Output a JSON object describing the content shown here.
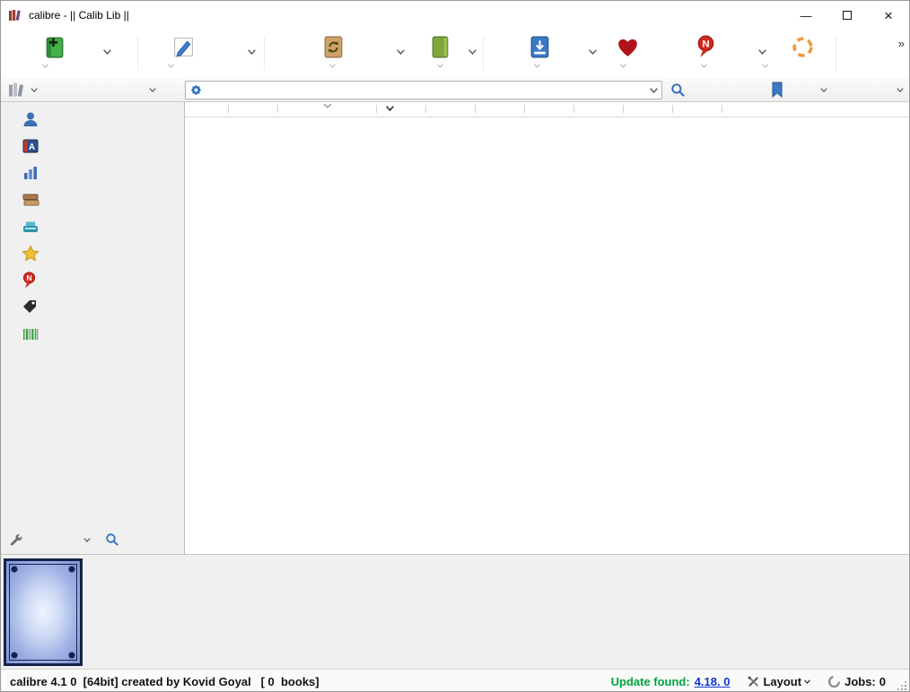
{
  "window": {
    "title": "calibre - || Calib Lib ||"
  },
  "window_controls": {
    "minimize_glyph": "—",
    "close_glyph": "×"
  },
  "toolbar": {
    "overflow_label": "»",
    "buttons": [
      {
        "id": "add-books",
        "icon": "add-books-icon",
        "has_menu": true
      },
      {
        "id": "edit-metadata",
        "icon": "edit-metadata-icon",
        "has_menu": true
      },
      {
        "id": "convert-books",
        "icon": "convert-books-icon",
        "has_menu": true
      },
      {
        "id": "view-book",
        "icon": "view-book-icon",
        "has_menu": true
      },
      {
        "id": "save-to-disk",
        "icon": "save-to-disk-icon",
        "has_menu": true
      },
      {
        "id": "donate",
        "icon": "donate-heart-icon",
        "has_menu": false
      },
      {
        "id": "fetch-news",
        "icon": "fetch-news-icon",
        "has_menu": true
      },
      {
        "id": "connect-share",
        "icon": "connect-share-icon",
        "has_menu": false
      }
    ]
  },
  "searchbar": {
    "library_switcher_icon": "library-books-icon",
    "gear_icon": "advanced-search-gear-icon",
    "search_value": "",
    "search_placeholder": "",
    "search_button_icon": "search-magnifier-icon",
    "saved_search_icon": "saved-search-bookmark-icon"
  },
  "sidebar": {
    "items": [
      {
        "id": "authors",
        "icon": "authors-icon"
      },
      {
        "id": "languages",
        "icon": "languages-icon"
      },
      {
        "id": "series",
        "icon": "series-icon"
      },
      {
        "id": "formats",
        "icon": "formats-icon"
      },
      {
        "id": "publisher",
        "icon": "publisher-icon"
      },
      {
        "id": "ratings",
        "icon": "ratings-star-icon"
      },
      {
        "id": "news",
        "icon": "news-icon"
      },
      {
        "id": "tags",
        "icon": "tags-icon"
      },
      {
        "id": "identifiers",
        "icon": "identifiers-barcode-icon"
      }
    ],
    "footer": {
      "configure_icon": "configure-wrench-icon",
      "find_icon": "find-magnifier-icon"
    }
  },
  "booklist": {
    "columns": [
      "",
      "",
      "",
      "",
      "",
      "",
      "",
      "",
      "",
      ""
    ]
  },
  "statusbar": {
    "left_text": "calibre 4.1 0  [64bit] created by Kovid Goyal   [ 0  books]",
    "update_label": "Update found:",
    "update_version_link": "4.18. 0",
    "layout_label": "Layout",
    "jobs_label": "Jobs:",
    "jobs_count": "0"
  },
  "colors": {
    "accent_blue": "#2f6fc1",
    "update_green": "#00a33e",
    "link_blue": "#1336c9",
    "heart_red": "#b1131a",
    "news_red": "#d1281e",
    "connect_orange": "#ef9b3f"
  }
}
